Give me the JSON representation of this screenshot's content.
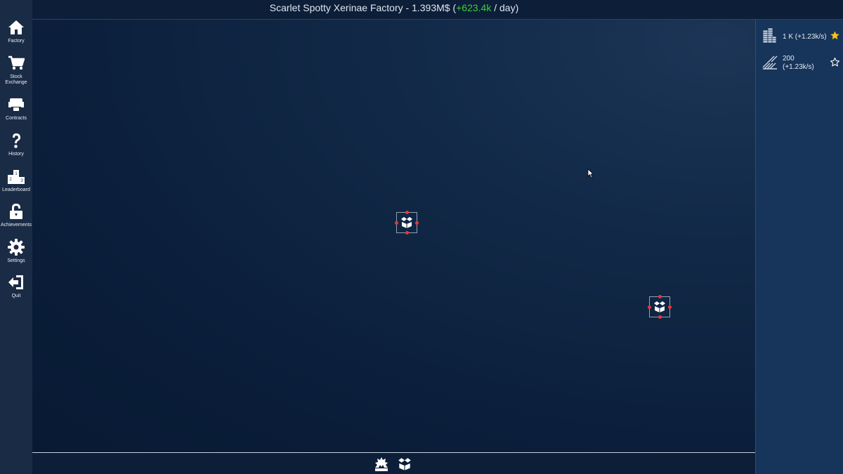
{
  "header": {
    "title_prefix": "Scarlet Spotty Xerinae Factory - 1.393M$ (",
    "gain": "+623.4k",
    "title_suffix": " / day)"
  },
  "sidebar": {
    "items": [
      {
        "label": "Factory",
        "icon": "home-icon"
      },
      {
        "label": "Stock\nExchange",
        "icon": "cart-icon"
      },
      {
        "label": "Contracts",
        "icon": "contracts-icon"
      },
      {
        "label": "History",
        "icon": "question-icon"
      },
      {
        "label": "Leaderboard",
        "icon": "podium-icon"
      },
      {
        "label": "Achievements",
        "icon": "lock-icon"
      },
      {
        "label": "Settings",
        "icon": "gear-icon"
      },
      {
        "label": "Quit",
        "icon": "exit-icon"
      }
    ]
  },
  "resources": [
    {
      "line1": "1 K (+1.23k/s)",
      "line2": "",
      "icon": "coin-stack-icon",
      "starred": true
    },
    {
      "line1": "200",
      "line2": "(+1.23k/s)",
      "icon": "ore-pile-icon",
      "starred": false
    }
  ],
  "machines": [
    {
      "icon": "open-box-icon"
    },
    {
      "icon": "open-box-icon"
    }
  ],
  "toolbar": {
    "tools": [
      {
        "icon": "mining-machine-icon"
      },
      {
        "icon": "open-box-icon"
      }
    ]
  },
  "colors": {
    "gain": "#39d13a",
    "port_dot": "#e53838",
    "star_active": "#f2c318"
  }
}
